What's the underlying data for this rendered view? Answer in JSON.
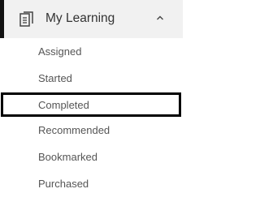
{
  "nav": {
    "section_title": "My Learning",
    "section_icon": "document-icon",
    "toggle_icon": "chevron-up-icon",
    "expanded": true,
    "accent_color": "#111111",
    "header_bg": "#f1f1f1",
    "items": [
      {
        "label": "Assigned"
      },
      {
        "label": "Started"
      },
      {
        "label": "Completed",
        "focused": true
      },
      {
        "label": "Recommended"
      },
      {
        "label": "Bookmarked"
      },
      {
        "label": "Purchased"
      }
    ]
  }
}
